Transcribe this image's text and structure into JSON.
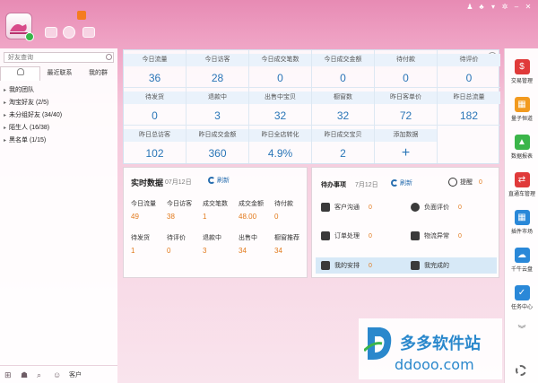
{
  "header": {
    "icons": [
      "avatar-image",
      "card-icon",
      "face-icon",
      "mail-icon"
    ],
    "window_controls": [
      "shirt-icon",
      "skin-icon",
      "menu-icon",
      "minimize-icon",
      "maximize-icon",
      "close-icon"
    ]
  },
  "left": {
    "search_placeholder": "好友查询",
    "tabs": [
      "",
      "最近联系",
      "我的群"
    ],
    "groups": [
      {
        "arrow": "▸",
        "label": "我的团队"
      },
      {
        "arrow": "▸",
        "label": "淘宝好友 (2/5)"
      },
      {
        "arrow": "▸",
        "label": "未分组好友 (34/40)"
      },
      {
        "arrow": "▸",
        "label": "陌生人 (16/38)"
      },
      {
        "arrow": "▸",
        "label": "黑名单 (1/15)"
      }
    ],
    "footer_label": "客户"
  },
  "stats": [
    {
      "label": "今日流量",
      "value": "36"
    },
    {
      "label": "今日访客",
      "value": "28"
    },
    {
      "label": "今日成交笔数",
      "value": "0"
    },
    {
      "label": "今日成交金额",
      "value": "0"
    },
    {
      "label": "待付款",
      "value": "0"
    },
    {
      "label": "待评价",
      "value": "0"
    },
    {
      "label": "待发货",
      "value": "0"
    },
    {
      "label": "退款中",
      "value": "3"
    },
    {
      "label": "出售中宝贝",
      "value": "32"
    },
    {
      "label": "橱窗数",
      "value": "32"
    },
    {
      "label": "昨日客单价",
      "value": "72"
    },
    {
      "label": "昨日总流量",
      "value": "182"
    },
    {
      "label": "昨日总访客",
      "value": "102"
    },
    {
      "label": "昨日成交金额",
      "value": "360"
    },
    {
      "label": "昨日全店转化",
      "value": "4.9%"
    },
    {
      "label": "昨日成交宝贝",
      "value": "2"
    },
    {
      "label": "添加数据",
      "value": "+"
    }
  ],
  "realtime": {
    "title": "实时数据",
    "date": "07月12日",
    "refresh": "刷新",
    "row1": [
      {
        "label": "今日流量",
        "value": "49"
      },
      {
        "label": "今日访客",
        "value": "38"
      },
      {
        "label": "成交笔数",
        "value": "1"
      },
      {
        "label": "成交金额",
        "value": "48.00"
      },
      {
        "label": "待付款",
        "value": "0"
      }
    ],
    "row2": [
      {
        "label": "待发货",
        "value": "1"
      },
      {
        "label": "待评价",
        "value": "0"
      },
      {
        "label": "退款中",
        "value": "3"
      },
      {
        "label": "出售中",
        "value": "34"
      },
      {
        "label": "橱窗推荐",
        "value": "34"
      }
    ]
  },
  "todo": {
    "title": "待办事项",
    "date": "7月12日",
    "refresh": "刷新",
    "remind_label": "提醒",
    "remind_count": "0",
    "items": [
      {
        "icon": "people-icon",
        "label": "客户沟通",
        "count": "0"
      },
      {
        "icon": "negative-review-icon",
        "label": "负面评价",
        "count": "0"
      },
      {
        "icon": "order-icon",
        "label": "订单处理",
        "count": "0"
      },
      {
        "icon": "logistics-icon",
        "label": "物流异常",
        "count": "0"
      },
      {
        "icon": "schedule-icon",
        "label": "我的安排",
        "count": "0"
      },
      {
        "icon": "done-icon",
        "label": "我完成的",
        "count": ""
      }
    ]
  },
  "right_bar": {
    "items": [
      {
        "label": "交易管理",
        "color": "#e03a3a",
        "glyph": "$"
      },
      {
        "label": "量子恒道",
        "color": "#f29a1f",
        "glyph": "▦"
      },
      {
        "label": "数据报表",
        "color": "#3bb54a",
        "glyph": "▲"
      },
      {
        "label": "直通车管理",
        "color": "#e03a3a",
        "glyph": "⇄"
      },
      {
        "label": "插件市场",
        "color": "#2a88d8",
        "glyph": "▦"
      },
      {
        "label": "千牛云盘",
        "color": "#2a88d8",
        "glyph": "☁"
      },
      {
        "label": "任务中心",
        "color": "#2a88d8",
        "glyph": "✓"
      }
    ],
    "more": "︾"
  },
  "watermark": {
    "title": "多多软件站",
    "url": "ddooo.com"
  }
}
